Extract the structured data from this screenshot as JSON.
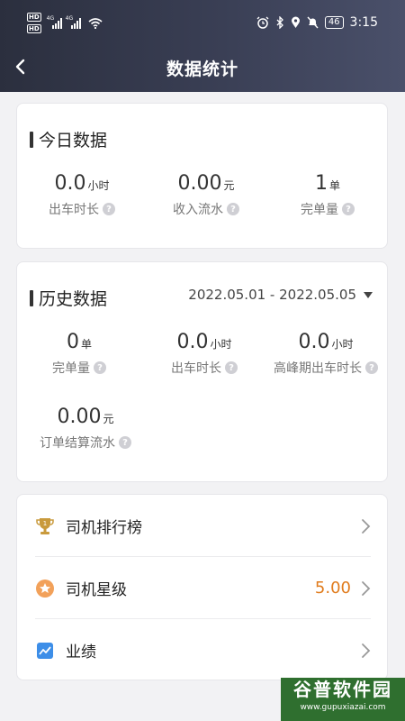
{
  "status_bar": {
    "hd1": "HD",
    "hd2": "HD",
    "signal_tag": "4G",
    "battery": "46",
    "time": "3:15"
  },
  "nav": {
    "title": "数据统计"
  },
  "today": {
    "title": "今日数据",
    "stats": [
      {
        "value": "0.0",
        "unit": "小时",
        "label": "出车时长"
      },
      {
        "value": "0.00",
        "unit": "元",
        "label": "收入流水"
      },
      {
        "value": "1",
        "unit": "单",
        "label": "完单量"
      }
    ]
  },
  "history": {
    "title": "历史数据",
    "date_range": "2022.05.01 - 2022.05.05",
    "stats": [
      {
        "value": "0",
        "unit": "单",
        "label": "完单量"
      },
      {
        "value": "0.0",
        "unit": "小时",
        "label": "出车时长"
      },
      {
        "value": "0.0",
        "unit": "小时",
        "label": "高峰期出车时长"
      },
      {
        "value": "0.00",
        "unit": "元",
        "label": "订单结算流水"
      }
    ]
  },
  "menu": {
    "items": [
      {
        "label": "司机排行榜",
        "icon": "trophy-icon"
      },
      {
        "label": "司机星级",
        "icon": "star-badge-icon",
        "extra": "5.00"
      },
      {
        "label": "业绩",
        "icon": "trend-chart-icon"
      }
    ]
  },
  "watermark": {
    "main": "谷普软件园",
    "sub": "www.gupuxiazai.com"
  },
  "colors": {
    "header_start": "#2b2f3e",
    "header_end": "#4a506a",
    "accent_orange": "#e07b1c",
    "background": "#f2f2f4"
  }
}
